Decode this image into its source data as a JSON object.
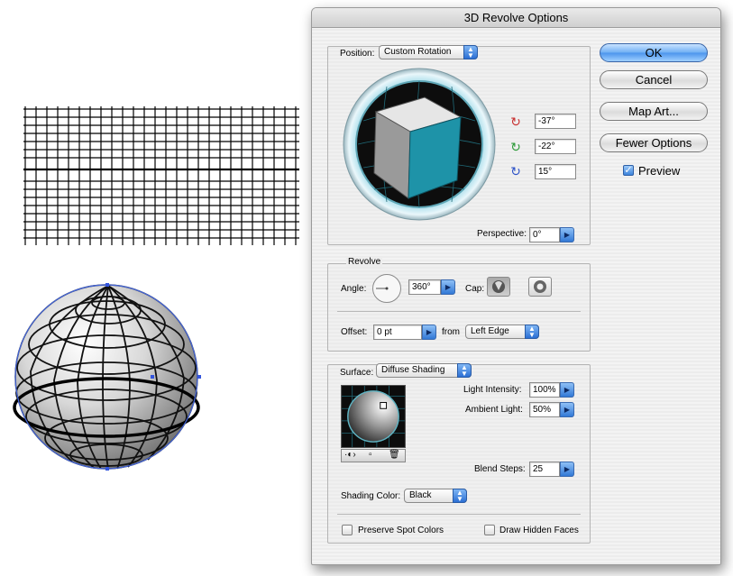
{
  "dialog": {
    "title": "3D Revolve Options",
    "position": {
      "label": "Position:",
      "preset": "Custom Rotation",
      "rot_x": "-37°",
      "rot_y": "-22°",
      "rot_z": "15°",
      "perspective_label": "Perspective:",
      "perspective": "0°"
    },
    "revolve": {
      "legend": "Revolve",
      "angle_label": "Angle:",
      "angle": "360°",
      "cap_label": "Cap:",
      "offset_label": "Offset:",
      "offset": "0 pt",
      "from_label": "from",
      "from_value": "Left Edge"
    },
    "surface": {
      "label": "Surface:",
      "value": "Diffuse Shading",
      "light_intensity_label": "Light Intensity:",
      "light_intensity": "100%",
      "ambient_light_label": "Ambient Light:",
      "ambient_light": "50%",
      "blend_steps_label": "Blend Steps:",
      "blend_steps": "25",
      "shading_color_label": "Shading Color:",
      "shading_color": "Black",
      "preserve_spot_label": "Preserve Spot Colors",
      "draw_hidden_label": "Draw Hidden Faces"
    },
    "buttons": {
      "ok": "OK",
      "cancel": "Cancel",
      "map_art": "Map Art...",
      "fewer_options": "Fewer Options"
    },
    "preview": {
      "label": "Preview",
      "checked": true
    }
  },
  "colors": {
    "cube_front": "#1e93a8",
    "accent_blue": "#3a86e0"
  },
  "icons": [
    "rotate-x-icon",
    "rotate-y-icon",
    "rotate-z-icon",
    "new-light-icon",
    "move-light-back-icon",
    "trash-icon"
  ]
}
